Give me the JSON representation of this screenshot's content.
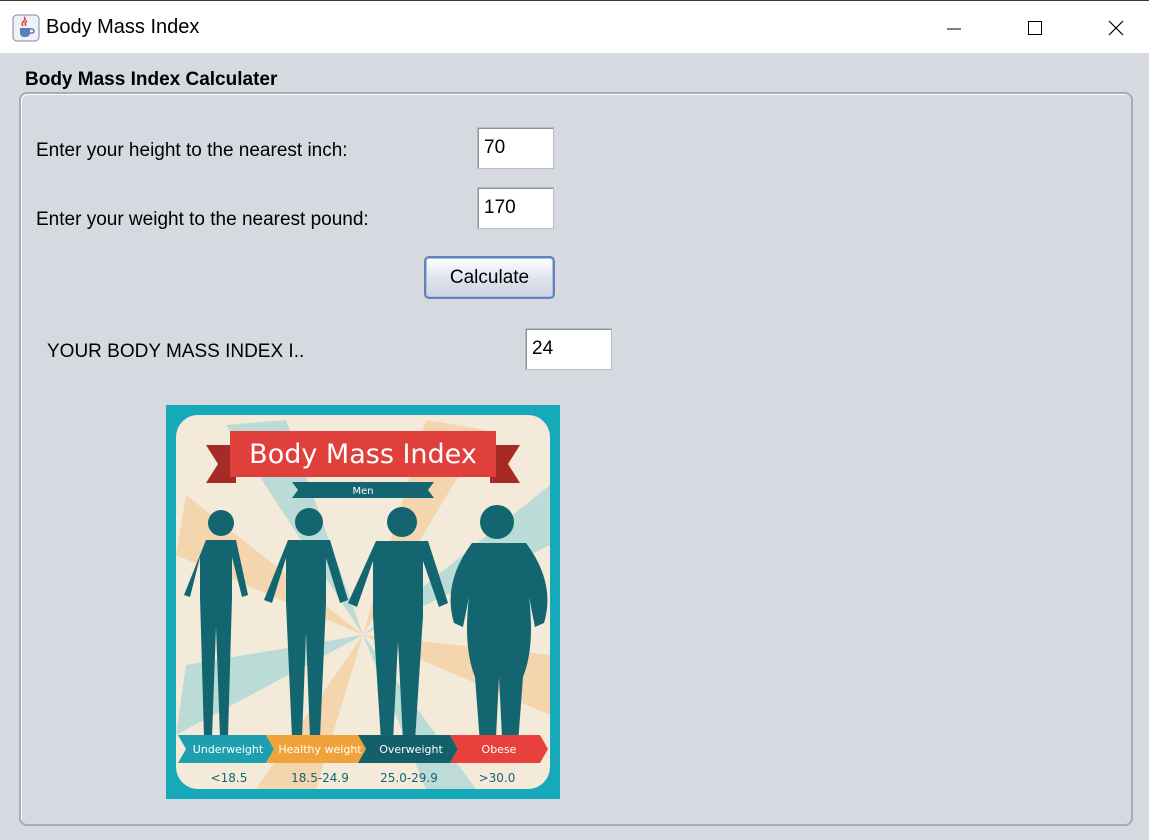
{
  "window": {
    "title": "Body Mass Index",
    "icon": "java-cup-icon",
    "controls": [
      "minimize-icon",
      "maximize-icon",
      "close-icon"
    ]
  },
  "panel": {
    "title": "Body Mass Index Calculater"
  },
  "form": {
    "height_label": "Enter your height to the nearest inch:",
    "height_value": "70",
    "weight_label": "Enter your weight to the nearest pound:",
    "weight_value": "170",
    "calculate_label": "Calculate",
    "result_label": "YOUR BODY MASS INDEX I..",
    "result_value": "24"
  },
  "poster": {
    "title": "Body Mass Index",
    "subtitle": "Men",
    "categories": [
      {
        "label": "Underweight",
        "range": "<18.5",
        "color": "#1e9fb0"
      },
      {
        "label": "Healthy weight",
        "range": "18.5-24.9",
        "color": "#f0a33a"
      },
      {
        "label": "Overweight",
        "range": "25.0-29.9",
        "color": "#13606a"
      },
      {
        "label": "Obese",
        "range": ">30.0",
        "color": "#e8413c"
      }
    ],
    "colors": {
      "frame": "#16a9b9",
      "background": "#f3ead9",
      "banner": "#e0403b",
      "silhouette": "#13666f"
    }
  }
}
